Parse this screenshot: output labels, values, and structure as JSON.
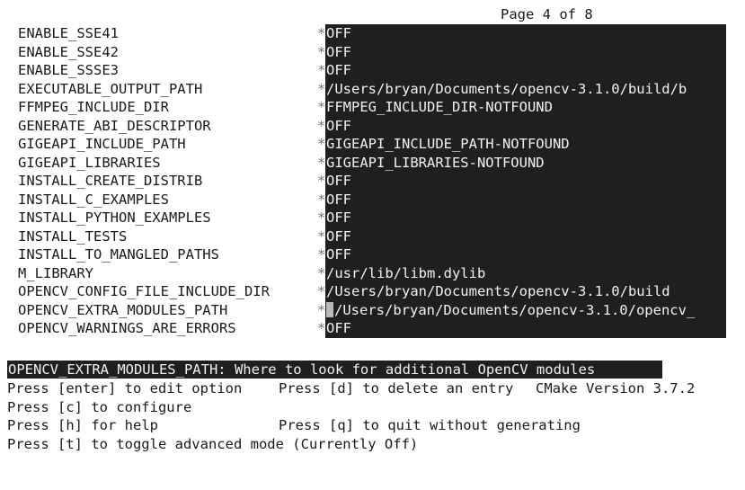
{
  "page_indicator": "Page 4 of 8",
  "marker": "*",
  "entries": [
    {
      "name": "ENABLE_SSE41",
      "value": "OFF"
    },
    {
      "name": "ENABLE_SSE42",
      "value": "OFF"
    },
    {
      "name": "ENABLE_SSSE3",
      "value": "OFF"
    },
    {
      "name": "EXECUTABLE_OUTPUT_PATH",
      "value": "/Users/bryan/Documents/opencv-3.1.0/build/b"
    },
    {
      "name": "FFMPEG_INCLUDE_DIR",
      "value": "FFMPEG_INCLUDE_DIR-NOTFOUND"
    },
    {
      "name": "GENERATE_ABI_DESCRIPTOR",
      "value": "OFF"
    },
    {
      "name": "GIGEAPI_INCLUDE_PATH",
      "value": "GIGEAPI_INCLUDE_PATH-NOTFOUND"
    },
    {
      "name": "GIGEAPI_LIBRARIES",
      "value": "GIGEAPI_LIBRARIES-NOTFOUND"
    },
    {
      "name": "INSTALL_CREATE_DISTRIB",
      "value": "OFF"
    },
    {
      "name": "INSTALL_C_EXAMPLES",
      "value": "OFF"
    },
    {
      "name": "INSTALL_PYTHON_EXAMPLES",
      "value": "OFF"
    },
    {
      "name": "INSTALL_TESTS",
      "value": "OFF"
    },
    {
      "name": "INSTALL_TO_MANGLED_PATHS",
      "value": "OFF"
    },
    {
      "name": "M_LIBRARY",
      "value": "/usr/lib/libm.dylib"
    },
    {
      "name": "OPENCV_CONFIG_FILE_INCLUDE_DIR",
      "value": "/Users/bryan/Documents/opencv-3.1.0/build"
    },
    {
      "name": "OPENCV_EXTRA_MODULES_PATH",
      "value": "/Users/bryan/Documents/opencv-3.1.0/opencv_",
      "selected": true
    },
    {
      "name": "OPENCV_WARNINGS_ARE_ERRORS",
      "value": "OFF"
    }
  ],
  "help_text": "OPENCV_EXTRA_MODULES_PATH: Where to look for additional OpenCV modules",
  "instructions": {
    "edit": "Press [enter] to edit option",
    "delete": "Press [d] to delete an entry",
    "version": "CMake Version 3.7.2",
    "configure": "Press [c] to configure",
    "help": "Press [h] for help",
    "quit": "Press [q] to quit without generating",
    "toggle": "Press [t] to toggle advanced mode (Currently Off)"
  },
  "colors": {
    "value_background": "#1f1f1f",
    "value_text": "#f2f2f2",
    "cursor": "#b9b9b9"
  }
}
